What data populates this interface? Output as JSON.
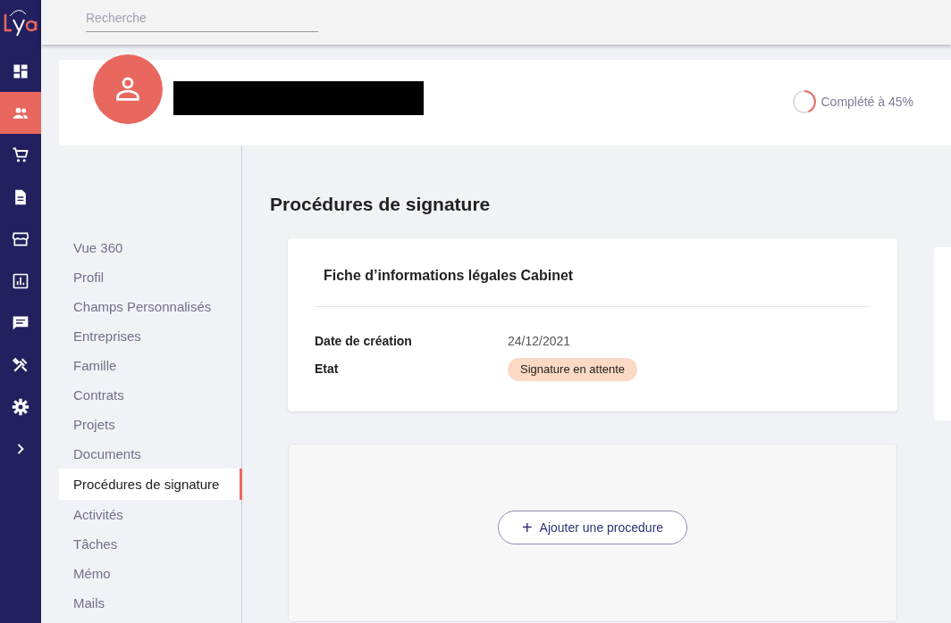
{
  "search": {
    "placeholder": "Recherche"
  },
  "nav_rail": [
    {
      "kind": "dashboard",
      "selected": false
    },
    {
      "kind": "people",
      "selected": true
    },
    {
      "kind": "cart",
      "selected": false
    },
    {
      "kind": "document",
      "selected": false
    },
    {
      "kind": "store",
      "selected": false
    },
    {
      "kind": "chart",
      "selected": false
    },
    {
      "kind": "chat",
      "selected": false
    },
    {
      "kind": "tools",
      "selected": false
    },
    {
      "kind": "settings",
      "selected": false
    },
    {
      "kind": "expand",
      "selected": false
    }
  ],
  "profile": {
    "completion": {
      "label": "Complété à 45%"
    }
  },
  "menu": [
    {
      "label": "Vue 360",
      "selected": false
    },
    {
      "label": "Profil",
      "selected": false
    },
    {
      "label": "Champs Personnalisés",
      "selected": false
    },
    {
      "label": "Entreprises",
      "selected": false
    },
    {
      "label": "Famille",
      "selected": false
    },
    {
      "label": "Contrats",
      "selected": false
    },
    {
      "label": "Projets",
      "selected": false
    },
    {
      "label": "Documents",
      "selected": false
    },
    {
      "label": "Procédures de signature",
      "selected": true
    },
    {
      "label": "Activités",
      "selected": false
    },
    {
      "label": "Tâches",
      "selected": false
    },
    {
      "label": "Mémo",
      "selected": false
    },
    {
      "label": "Mails",
      "selected": false
    }
  ],
  "page_title": "Procédures de signature",
  "procedures": [
    {
      "title": "Fiche d’informations légales Cabinet",
      "fields": [
        {
          "label": "Date de création",
          "value": "24/12/2021",
          "kind": "text"
        },
        {
          "label": "Etat",
          "value": "Signature en attente",
          "kind": "status"
        }
      ]
    }
  ],
  "add_button": {
    "icon": "+",
    "label": "Ajouter une procedure"
  }
}
